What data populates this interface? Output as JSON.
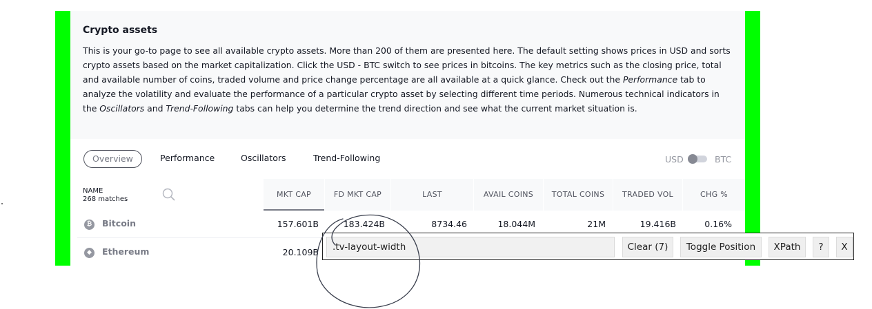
{
  "intro": {
    "title": "Crypto assets",
    "p1": "This is your go-to page to see all available crypto assets. More than 200 of them are presented here. The default setting shows prices in USD and sorts crypto assets based on the market capitalization. Click the USD - BTC switch to see prices in bitcoins. The key metrics such as the closing price, total and available number of coins, traded volume and price change percentage are all available at a quick glance. Check out the ",
    "em1": "Performance",
    "p2": " tab to analyze the volatility and evaluate the performance of a particular crypto asset by selecting different time periods. Numerous technical indicators in the ",
    "em2": "Oscillators",
    "p3": " and ",
    "em3": "Trend-Following",
    "p4": " tabs can help you determine the trend direction and see what the current market situation is."
  },
  "tabs": [
    "Overview",
    "Performance",
    "Oscillators",
    "Trend-Following"
  ],
  "currency": {
    "left": "USD",
    "right": "BTC"
  },
  "table": {
    "name_header": "NAME",
    "matches": "268 matches",
    "columns": [
      "MKT CAP",
      "FD MKT CAP",
      "LAST",
      "AVAIL COINS",
      "TOTAL COINS",
      "TRADED VOL",
      "CHG %"
    ],
    "rows": [
      {
        "icon": "bitcoin-icon",
        "icon_glyph": "₿",
        "name": "Bitcoin",
        "cells": [
          "157.601B",
          "183.424B",
          "8734.46",
          "18.044M",
          "21M",
          "19.416B",
          "0.16%"
        ]
      },
      {
        "icon": "ethereum-icon",
        "icon_glyph": "◆",
        "name": "Ethereum",
        "cells": [
          "20.109B"
        ]
      }
    ]
  },
  "xpath_helper": {
    "query": ".tv-layout-width",
    "clear": "Clear (7)",
    "toggle": "Toggle Position",
    "xpath": "XPath",
    "help": "?",
    "close": "X"
  },
  "colors": {
    "highlight": "#00ff00",
    "text": "#131722",
    "muted": "#787b86"
  }
}
